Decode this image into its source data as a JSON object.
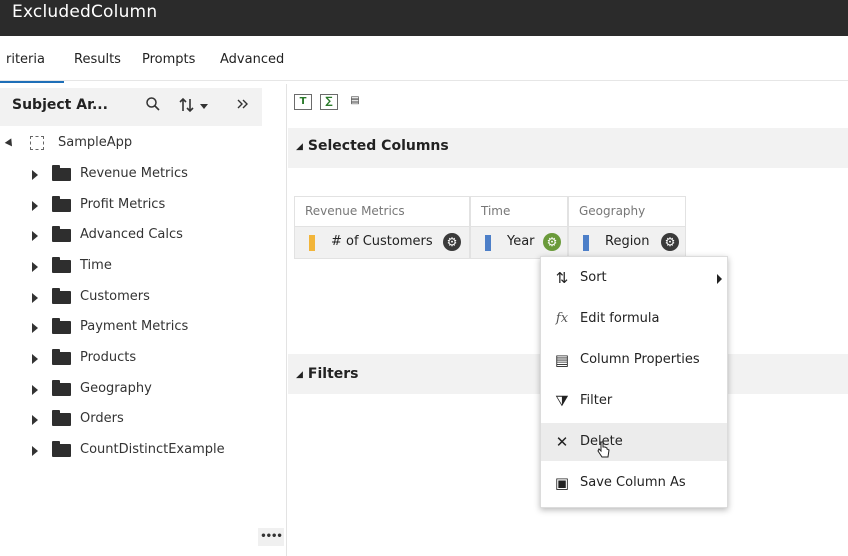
{
  "window": {
    "title": "ExcludedColumn"
  },
  "tabs": [
    "riteria",
    "Results",
    "Prompts",
    "Advanced"
  ],
  "left_panel": {
    "header_title": "Subject Ar...",
    "icons": [
      "search-icon",
      "sort-icon",
      "expand-panel-icon"
    ],
    "root_label": "SampleApp",
    "items": [
      "Revenue Metrics",
      "Profit Metrics",
      "Advanced Calcs",
      "Time",
      "Customers",
      "Payment Metrics",
      "Products",
      "Geography",
      "Orders",
      "CountDistinctExample"
    ],
    "collapse_label": "••••"
  },
  "toolbar": {
    "buttons": [
      "T",
      "∑",
      "▤"
    ]
  },
  "sections": {
    "selected_columns": "Selected Columns",
    "filters": "Filters"
  },
  "columns": [
    {
      "folder": "Revenue Metrics",
      "name": "# of Customers",
      "chip_color": "#f2b53a"
    },
    {
      "folder": "Time",
      "name": "Year",
      "chip_color": "#4d7fc8"
    },
    {
      "folder": "Geography",
      "name": "Region",
      "chip_color": "#4d7fc8"
    }
  ],
  "context_menu": {
    "items": [
      {
        "label": "Sort",
        "icon": "⇅",
        "submenu": true
      },
      {
        "label": "Edit formula",
        "icon": "fx"
      },
      {
        "label": "Column Properties",
        "icon": "▤"
      },
      {
        "label": "Filter",
        "icon": "⧩"
      },
      {
        "label": "Delete",
        "icon": "✕",
        "hovered": true
      },
      {
        "label": "Save Column As",
        "icon": "▣"
      }
    ]
  },
  "colors": {
    "titlebar": "#2b2b2b",
    "tab_underline": "#1e6fb8",
    "header_bg": "#f2f2f2",
    "menu_hover": "#ececec"
  }
}
